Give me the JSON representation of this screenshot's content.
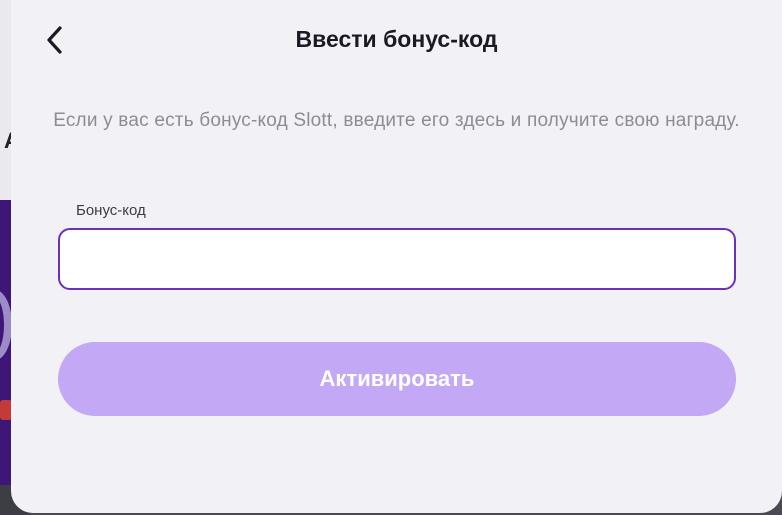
{
  "modal": {
    "title": "Ввести бонус-код",
    "description": "Если у вас есть бонус-код Slott, введите его здесь и получите свою награду.",
    "field_label": "Бонус-код",
    "field_value": "",
    "field_placeholder": "",
    "activate_label": "Активировать",
    "back_icon": "chevron-left-icon"
  },
  "background": {
    "partial_letter": "A"
  },
  "colors": {
    "accent": "#6f2fb8",
    "button_disabled": "#c2a8f5",
    "modal_bg": "#f2f2f6",
    "text_muted": "#8c8c96"
  }
}
